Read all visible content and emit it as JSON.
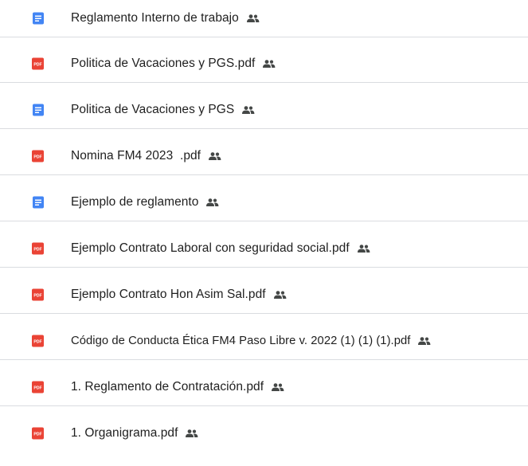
{
  "files": [
    {
      "type": "doc",
      "icon": "google-docs-icon",
      "name": "Reglamento Interno de trabajo",
      "shared": true
    },
    {
      "type": "pdf",
      "icon": "pdf-icon",
      "icon_label": "PDF",
      "name": "Politica de Vacaciones y PGS.pdf",
      "shared": true
    },
    {
      "type": "doc",
      "icon": "google-docs-icon",
      "name": "Politica de Vacaciones y PGS",
      "shared": true
    },
    {
      "type": "pdf",
      "icon": "pdf-icon",
      "icon_label": "PDF",
      "name": "Nomina FM4 2023  .pdf",
      "shared": true
    },
    {
      "type": "doc",
      "icon": "google-docs-icon",
      "name": "Ejemplo de reglamento",
      "shared": true
    },
    {
      "type": "pdf",
      "icon": "pdf-icon",
      "icon_label": "PDF",
      "name": "Ejemplo Contrato Laboral con seguridad social.pdf",
      "shared": true
    },
    {
      "type": "pdf",
      "icon": "pdf-icon",
      "icon_label": "PDF",
      "name": "Ejemplo Contrato Hon Asim Sal.pdf",
      "shared": true
    },
    {
      "type": "pdf",
      "icon": "pdf-icon",
      "icon_label": "PDF",
      "name": "Código de Conducta Ética FM4 Paso Libre v. 2022 (1) (1) (1).pdf",
      "shared": true
    },
    {
      "type": "pdf",
      "icon": "pdf-icon",
      "icon_label": "PDF",
      "name": "1. Reglamento de Contratación.pdf",
      "shared": true
    },
    {
      "type": "pdf",
      "icon": "pdf-icon",
      "icon_label": "PDF",
      "name": "1. Organigrama.pdf",
      "shared": true
    }
  ],
  "colors": {
    "doc_blue": "#4285f4",
    "pdf_red": "#ea4335",
    "text": "#1f1f1f",
    "shared_icon": "#444746",
    "divider": "#dadce0"
  }
}
